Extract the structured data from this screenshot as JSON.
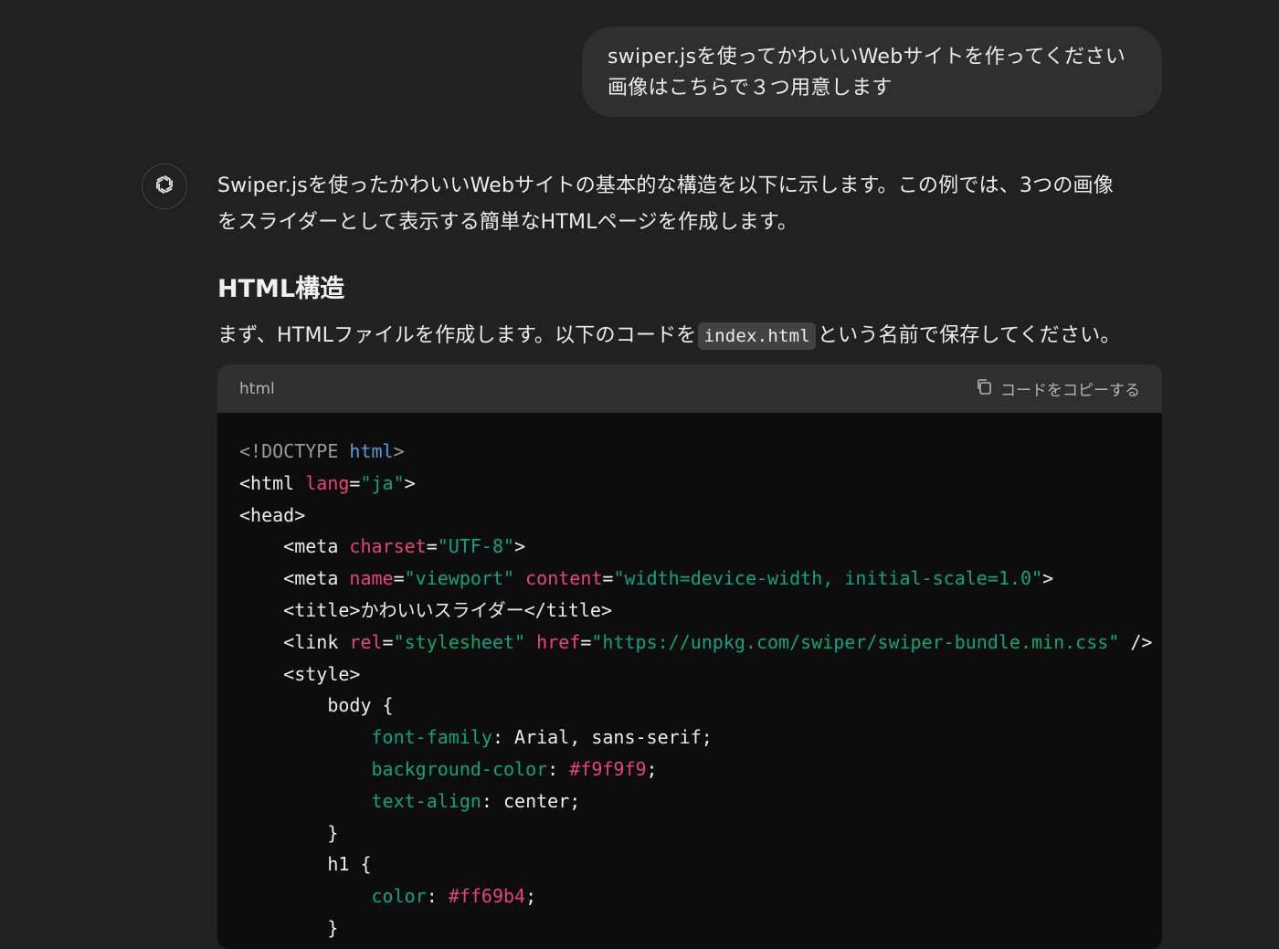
{
  "user_message": {
    "lines": [
      "swiper.jsを使ってかわいいWebサイトを作ってください",
      "画像はこちらで３つ用意します"
    ]
  },
  "assistant": {
    "avatar_icon": "openai-logo-icon",
    "intro_lines": [
      "Swiper.jsを使ったかわいいWebサイトの基本的な構造を以下に示します。この例では、3つの画像",
      "をスライダーとして表示する簡単なHTMLページを作成します。"
    ],
    "heading": "HTML構造",
    "para2_before": "まず、HTMLファイルを作成します。以下のコードを",
    "para2_code": "index.html",
    "para2_after": "という名前で保存してください。"
  },
  "code_block": {
    "language": "html",
    "copy_label": "コードをコピーする",
    "copy_icon": "copy-icon",
    "lines": [
      [
        {
          "t": "<!DOCTYPE ",
          "c": "gray"
        },
        {
          "t": "html",
          "c": "blue"
        },
        {
          "t": ">",
          "c": "gray"
        }
      ],
      [
        {
          "t": "<html ",
          "c": "white"
        },
        {
          "t": "lang",
          "c": "red"
        },
        {
          "t": "=",
          "c": "white"
        },
        {
          "t": "\"ja\"",
          "c": "green"
        },
        {
          "t": ">",
          "c": "white"
        }
      ],
      [
        {
          "t": "<head>",
          "c": "white"
        }
      ],
      [
        {
          "t": "    <meta ",
          "c": "white"
        },
        {
          "t": "charset",
          "c": "red"
        },
        {
          "t": "=",
          "c": "white"
        },
        {
          "t": "\"UTF-8\"",
          "c": "green"
        },
        {
          "t": ">",
          "c": "white"
        }
      ],
      [
        {
          "t": "    <meta ",
          "c": "white"
        },
        {
          "t": "name",
          "c": "red"
        },
        {
          "t": "=",
          "c": "white"
        },
        {
          "t": "\"viewport\"",
          "c": "green"
        },
        {
          "t": " ",
          "c": "white"
        },
        {
          "t": "content",
          "c": "red"
        },
        {
          "t": "=",
          "c": "white"
        },
        {
          "t": "\"width=device-width, initial-scale=1.0\"",
          "c": "green"
        },
        {
          "t": ">",
          "c": "white"
        }
      ],
      [
        {
          "t": "    <title>かわいいスライダー</title>",
          "c": "white"
        }
      ],
      [
        {
          "t": "    <link ",
          "c": "white"
        },
        {
          "t": "rel",
          "c": "red"
        },
        {
          "t": "=",
          "c": "white"
        },
        {
          "t": "\"stylesheet\"",
          "c": "green"
        },
        {
          "t": " ",
          "c": "white"
        },
        {
          "t": "href",
          "c": "red"
        },
        {
          "t": "=",
          "c": "white"
        },
        {
          "t": "\"https://unpkg.com/swiper/swiper-bundle.min.css\"",
          "c": "green"
        },
        {
          "t": " />",
          "c": "white"
        }
      ],
      [
        {
          "t": "    <style>",
          "c": "white"
        }
      ],
      [
        {
          "t": "        body {",
          "c": "white"
        }
      ],
      [
        {
          "t": "            ",
          "c": "white"
        },
        {
          "t": "font-family",
          "c": "green"
        },
        {
          "t": ": Arial, sans-serif;",
          "c": "white"
        }
      ],
      [
        {
          "t": "            ",
          "c": "white"
        },
        {
          "t": "background-color",
          "c": "green"
        },
        {
          "t": ": ",
          "c": "white"
        },
        {
          "t": "#f9f9f9",
          "c": "red"
        },
        {
          "t": ";",
          "c": "white"
        }
      ],
      [
        {
          "t": "            ",
          "c": "white"
        },
        {
          "t": "text-align",
          "c": "green"
        },
        {
          "t": ": center;",
          "c": "white"
        }
      ],
      [
        {
          "t": "        }",
          "c": "white"
        }
      ],
      [
        {
          "t": "        h1 {",
          "c": "white"
        }
      ],
      [
        {
          "t": "            ",
          "c": "white"
        },
        {
          "t": "color",
          "c": "green"
        },
        {
          "t": ": ",
          "c": "white"
        },
        {
          "t": "#ff69b4",
          "c": "red"
        },
        {
          "t": ";",
          "c": "white"
        }
      ],
      [
        {
          "t": "        }",
          "c": "white"
        }
      ]
    ]
  },
  "colors": {
    "background": "#212121",
    "bubble": "#2f2f2f",
    "code_bg": "#0d0d0d",
    "tag_gray": "#9a9a9a",
    "keyword_blue": "#569cd6",
    "attr_red": "#e8447a",
    "string_green": "#10a37f"
  }
}
